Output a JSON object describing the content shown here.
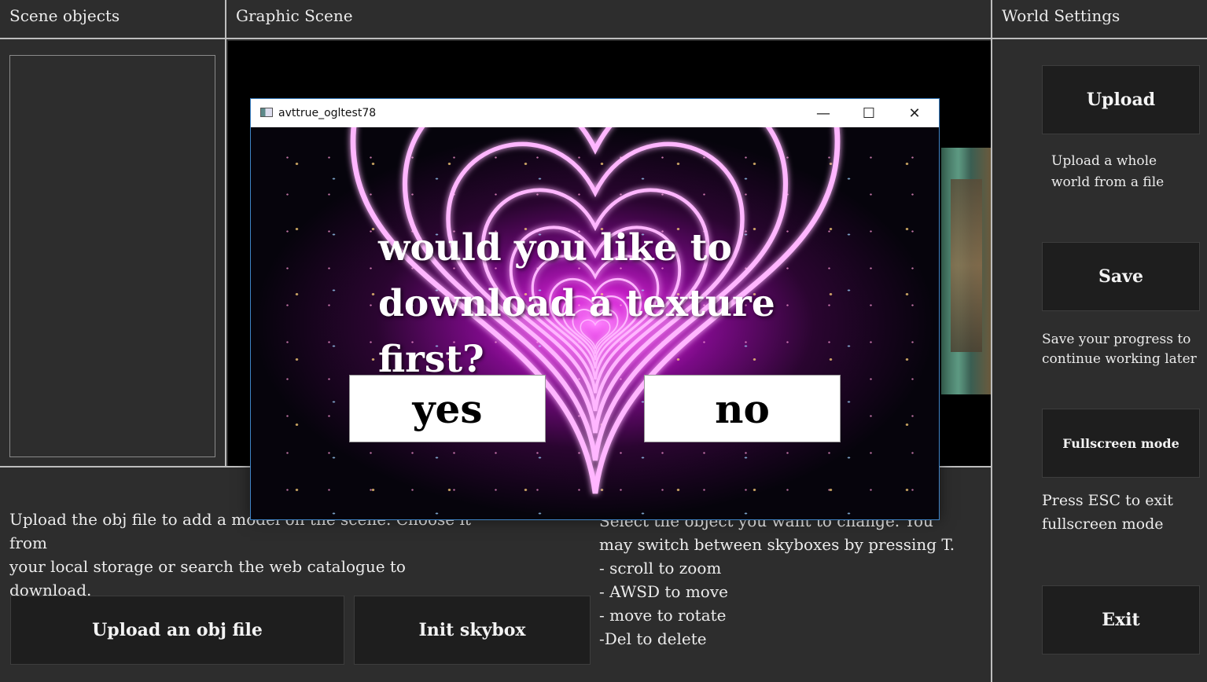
{
  "panels": {
    "scene_objects": "Scene objects",
    "graphic_scene": "Graphic Scene",
    "world_settings": "World Settings"
  },
  "bottom": {
    "left_desc_line1": "Upload the obj file to add a model on the scene. Choose it from",
    "left_desc_line2": "your local storage or search the web catalogue to download.",
    "upload_obj_label": "Upload an obj file",
    "init_skybox_label": "Init skybox",
    "right_desc_line1": "Select the object you want to change. You",
    "right_desc_line2": "may switch between skyboxes by pressing T.",
    "right_desc_line3": "- scroll to zoom",
    "right_desc_line4": "- AWSD to move",
    "right_desc_line5": "- move to rotate",
    "right_desc_line6": "-Del to delete"
  },
  "sidebar": {
    "upload_label": "Upload",
    "upload_desc_line1": "Upload a whole",
    "upload_desc_line2": "world from a file",
    "save_label": "Save",
    "save_desc_line1": "Save your progress to",
    "save_desc_line2": "continue working later",
    "fullscreen_label": "Fullscreen mode",
    "fullscreen_desc_line1": "Press ESC to exit",
    "fullscreen_desc_line2": "fullscreen mode",
    "exit_label": "Exit"
  },
  "dialog": {
    "window_title": "avttrue_ogltest78",
    "minimize_glyph": "—",
    "maximize_glyph": "☐",
    "close_glyph": "✕",
    "question_line1": "would you like to",
    "question_line2": "download a texture first?",
    "yes_label": "yes",
    "no_label": "no"
  }
}
